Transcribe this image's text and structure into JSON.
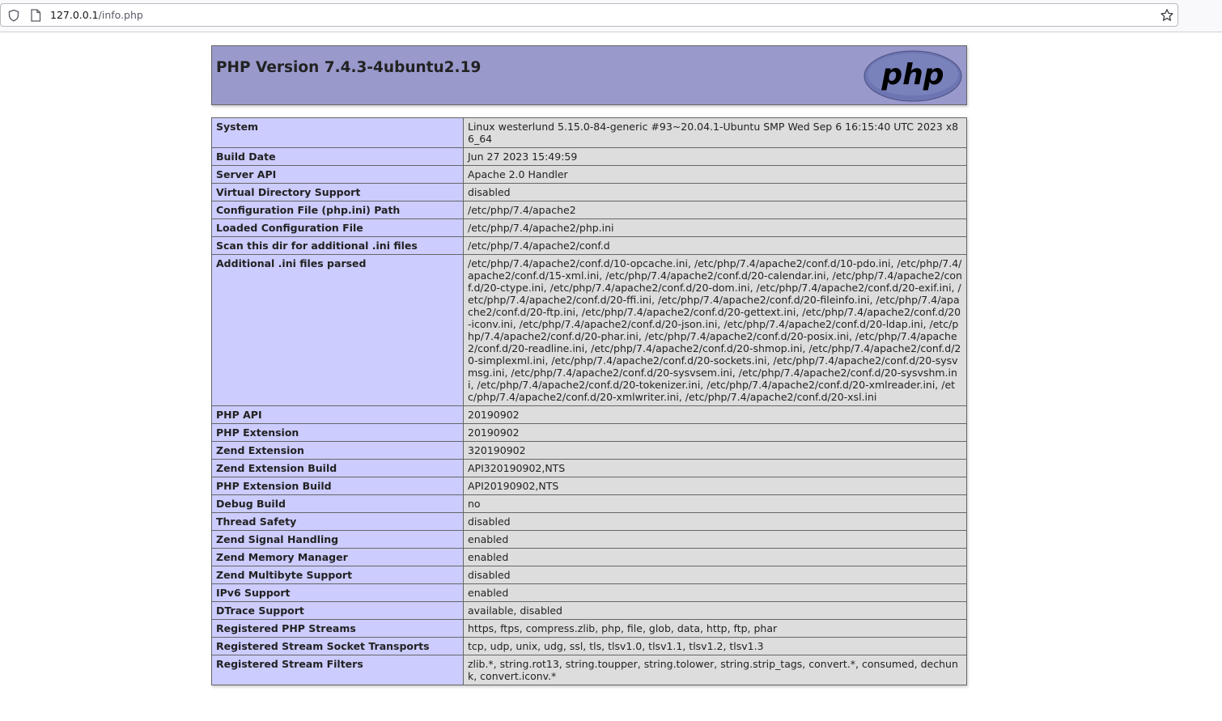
{
  "browser": {
    "url_host": "127.0.0.1",
    "url_path": "/info.php"
  },
  "header": {
    "title": "PHP Version 7.4.3-4ubuntu2.19",
    "logo_text": "php"
  },
  "colors": {
    "header_bg": "#9999cc",
    "key_bg": "#ccccff",
    "value_bg": "#dddddd",
    "border": "#666666"
  },
  "rows": [
    {
      "key": "System",
      "value": "Linux westerlund 5.15.0-84-generic #93~20.04.1-Ubuntu SMP Wed Sep 6 16:15:40 UTC 2023 x86_64"
    },
    {
      "key": "Build Date",
      "value": "Jun 27 2023 15:49:59"
    },
    {
      "key": "Server API",
      "value": "Apache 2.0 Handler"
    },
    {
      "key": "Virtual Directory Support",
      "value": "disabled"
    },
    {
      "key": "Configuration File (php.ini) Path",
      "value": "/etc/php/7.4/apache2"
    },
    {
      "key": "Loaded Configuration File",
      "value": "/etc/php/7.4/apache2/php.ini"
    },
    {
      "key": "Scan this dir for additional .ini files",
      "value": "/etc/php/7.4/apache2/conf.d"
    },
    {
      "key": "Additional .ini files parsed",
      "value": "/etc/php/7.4/apache2/conf.d/10-opcache.ini, /etc/php/7.4/apache2/conf.d/10-pdo.ini, /etc/php/7.4/apache2/conf.d/15-xml.ini, /etc/php/7.4/apache2/conf.d/20-calendar.ini, /etc/php/7.4/apache2/conf.d/20-ctype.ini, /etc/php/7.4/apache2/conf.d/20-dom.ini, /etc/php/7.4/apache2/conf.d/20-exif.ini, /etc/php/7.4/apache2/conf.d/20-ffi.ini, /etc/php/7.4/apache2/conf.d/20-fileinfo.ini, /etc/php/7.4/apache2/conf.d/20-ftp.ini, /etc/php/7.4/apache2/conf.d/20-gettext.ini, /etc/php/7.4/apache2/conf.d/20-iconv.ini, /etc/php/7.4/apache2/conf.d/20-json.ini, /etc/php/7.4/apache2/conf.d/20-ldap.ini, /etc/php/7.4/apache2/conf.d/20-phar.ini, /etc/php/7.4/apache2/conf.d/20-posix.ini, /etc/php/7.4/apache2/conf.d/20-readline.ini, /etc/php/7.4/apache2/conf.d/20-shmop.ini, /etc/php/7.4/apache2/conf.d/20-simplexml.ini, /etc/php/7.4/apache2/conf.d/20-sockets.ini, /etc/php/7.4/apache2/conf.d/20-sysvmsg.ini, /etc/php/7.4/apache2/conf.d/20-sysvsem.ini, /etc/php/7.4/apache2/conf.d/20-sysvshm.ini, /etc/php/7.4/apache2/conf.d/20-tokenizer.ini, /etc/php/7.4/apache2/conf.d/20-xmlreader.ini, /etc/php/7.4/apache2/conf.d/20-xmlwriter.ini, /etc/php/7.4/apache2/conf.d/20-xsl.ini"
    },
    {
      "key": "PHP API",
      "value": "20190902"
    },
    {
      "key": "PHP Extension",
      "value": "20190902"
    },
    {
      "key": "Zend Extension",
      "value": "320190902"
    },
    {
      "key": "Zend Extension Build",
      "value": "API320190902,NTS"
    },
    {
      "key": "PHP Extension Build",
      "value": "API20190902,NTS"
    },
    {
      "key": "Debug Build",
      "value": "no"
    },
    {
      "key": "Thread Safety",
      "value": "disabled"
    },
    {
      "key": "Zend Signal Handling",
      "value": "enabled"
    },
    {
      "key": "Zend Memory Manager",
      "value": "enabled"
    },
    {
      "key": "Zend Multibyte Support",
      "value": "disabled"
    },
    {
      "key": "IPv6 Support",
      "value": "enabled"
    },
    {
      "key": "DTrace Support",
      "value": "available, disabled"
    },
    {
      "key": "Registered PHP Streams",
      "value": "https, ftps, compress.zlib, php, file, glob, data, http, ftp, phar"
    },
    {
      "key": "Registered Stream Socket Transports",
      "value": "tcp, udp, unix, udg, ssl, tls, tlsv1.0, tlsv1.1, tlsv1.2, tlsv1.3"
    },
    {
      "key": "Registered Stream Filters",
      "value": "zlib.*, string.rot13, string.toupper, string.tolower, string.strip_tags, convert.*, consumed, dechunk, convert.iconv.*"
    }
  ]
}
